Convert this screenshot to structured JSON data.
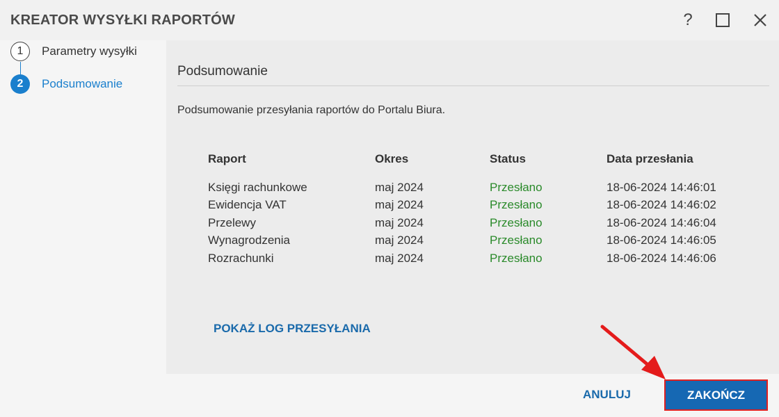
{
  "window": {
    "title": "KREATOR WYSYŁKI RAPORTÓW",
    "help_label": "?"
  },
  "steps": [
    {
      "number": "1",
      "label": "Parametry wysyłki",
      "state": "done"
    },
    {
      "number": "2",
      "label": "Podsumowanie",
      "state": "active"
    }
  ],
  "content": {
    "section_title": "Podsumowanie",
    "description": "Podsumowanie przesyłania raportów do Portalu Biura.",
    "table": {
      "headers": [
        "Raport",
        "Okres",
        "Status",
        "Data przesłania"
      ],
      "rows": [
        [
          "Księgi rachunkowe",
          "maj 2024",
          "Przesłano",
          "18-06-2024 14:46:01"
        ],
        [
          "Ewidencja VAT",
          "maj 2024",
          "Przesłano",
          "18-06-2024 14:46:02"
        ],
        [
          "Przelewy",
          "maj 2024",
          "Przesłano",
          "18-06-2024 14:46:04"
        ],
        [
          "Wynagrodzenia",
          "maj 2024",
          "Przesłano",
          "18-06-2024 14:46:05"
        ],
        [
          "Rozrachunki",
          "maj 2024",
          "Przesłano",
          "18-06-2024 14:46:06"
        ]
      ]
    },
    "log_link": "POKAŻ LOG PRZESYŁANIA"
  },
  "footer": {
    "cancel_label": "ANULUJ",
    "finish_label": "ZAKOŃCZ"
  },
  "colors": {
    "accent": "#1a7fcd",
    "link": "#1a6aab",
    "primary_button": "#1668b3",
    "status_success": "#2a8a2a",
    "annotation": "#e02020"
  }
}
